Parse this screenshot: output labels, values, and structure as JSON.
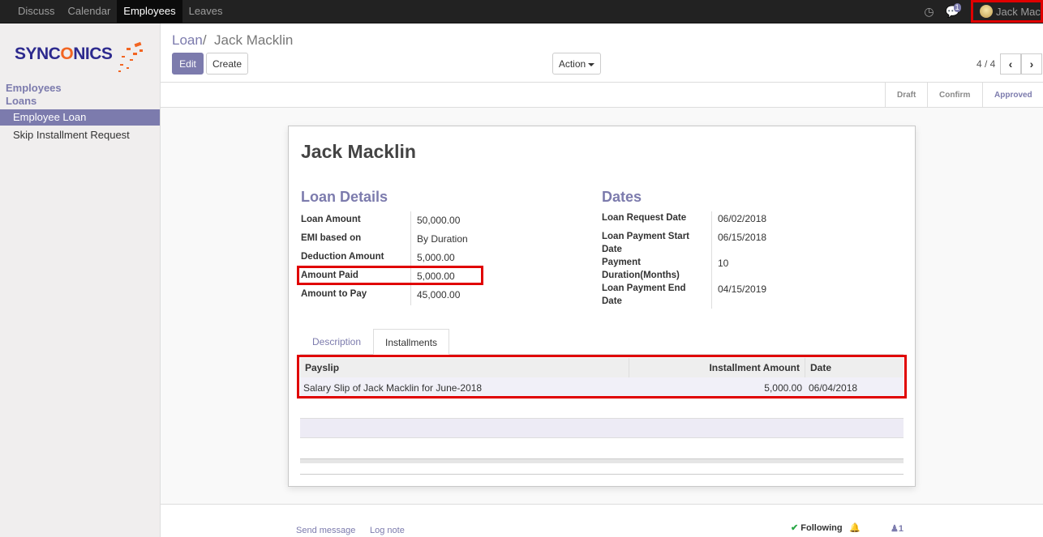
{
  "topbar": {
    "menu": [
      "Discuss",
      "Calendar",
      "Employees",
      "Leaves"
    ],
    "active_menu": "Employees",
    "messages_badge": "1",
    "user": "Jack Macklin"
  },
  "sidebar": {
    "logo_text_a": "SYNC",
    "logo_text_o": "O",
    "logo_text_b": "NICS",
    "categories": [
      "Employees",
      "Loans"
    ],
    "items": [
      {
        "label": "Employee Loan",
        "active": true
      },
      {
        "label": "Skip Installment Request",
        "active": false
      }
    ]
  },
  "breadcrumb": {
    "parent": "Loan",
    "sep": "/",
    "current": "Jack Macklin"
  },
  "buttons": {
    "edit": "Edit",
    "create": "Create",
    "action": "Action"
  },
  "pager": {
    "text": "4 / 4"
  },
  "status_stages": [
    "Draft",
    "Confirm",
    "Approved"
  ],
  "active_stage": "Approved",
  "record": {
    "name": "Jack Macklin",
    "loan_details_title": "Loan Details",
    "dates_title": "Dates",
    "loan_details": [
      {
        "label": "Loan Amount",
        "value": "50,000.00"
      },
      {
        "label": "EMI based on",
        "value": "By Duration"
      },
      {
        "label": "Deduction Amount",
        "value": "5,000.00"
      },
      {
        "label": "Amount Paid",
        "value": "5,000.00"
      },
      {
        "label": "Amount to Pay",
        "value": "45,000.00"
      }
    ],
    "dates": [
      {
        "label_1": "Loan Request Date",
        "label_2": "",
        "value": "06/02/2018"
      },
      {
        "label_1": "Loan Payment Start",
        "label_2": "Date",
        "value": "06/15/2018"
      },
      {
        "label_1": "Payment",
        "label_2": "Duration(Months)",
        "value": "10"
      },
      {
        "label_1": "Loan Payment End",
        "label_2": "Date",
        "value": "04/15/2019"
      }
    ]
  },
  "tabs": [
    "Description",
    "Installments"
  ],
  "active_tab": "Installments",
  "installments": {
    "columns": [
      "Payslip",
      "Installment Amount",
      "Date"
    ],
    "rows": [
      {
        "payslip": "Salary Slip of Jack Macklin for June-2018",
        "amount": "5,000.00",
        "date": "06/04/2018"
      }
    ]
  },
  "chatter": {
    "send_message": "Send message",
    "log_note": "Log note",
    "following": "Following",
    "followers": "1"
  },
  "colors": {
    "accent": "#7c7bad",
    "highlight": "#e00000",
    "navbar": "#222222"
  }
}
